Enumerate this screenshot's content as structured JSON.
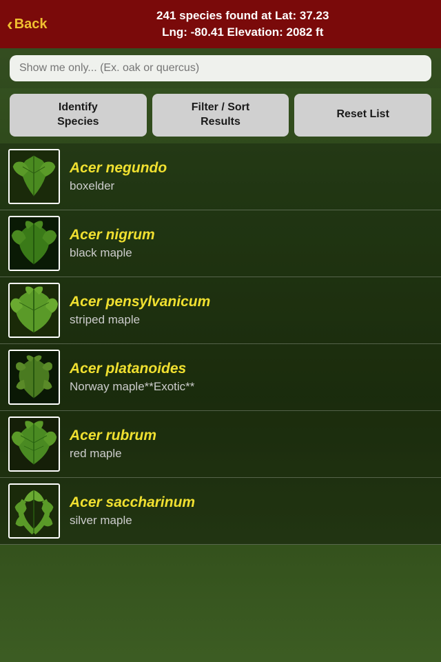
{
  "header": {
    "back_label": "Back",
    "title_line1": "241 species found at Lat: 37.23",
    "title_line2": "Lng: -80.41 Elevation: 2082 ft"
  },
  "search": {
    "placeholder": "Show me only... (Ex. oak or quercus)"
  },
  "buttons": {
    "identify": "Identify\nSpecies",
    "filter": "Filter / Sort\nResults",
    "reset": "Reset List"
  },
  "species": [
    {
      "scientific": "Acer negundo",
      "common": "boxelder",
      "leaf_color": "#4a7a2a"
    },
    {
      "scientific": "Acer nigrum",
      "common": "black maple",
      "leaf_color": "#3a6a1a"
    },
    {
      "scientific": "Acer pensylvanicum",
      "common": "striped maple",
      "leaf_color": "#5a8a30"
    },
    {
      "scientific": "Acer platanoides",
      "common": "Norway maple**Exotic**",
      "leaf_color": "#4a6a20"
    },
    {
      "scientific": "Acer rubrum",
      "common": "red maple",
      "leaf_color": "#3a5a1a"
    },
    {
      "scientific": "Acer saccharinum",
      "common": "silver maple",
      "leaf_color": "#5a7a2a"
    }
  ]
}
